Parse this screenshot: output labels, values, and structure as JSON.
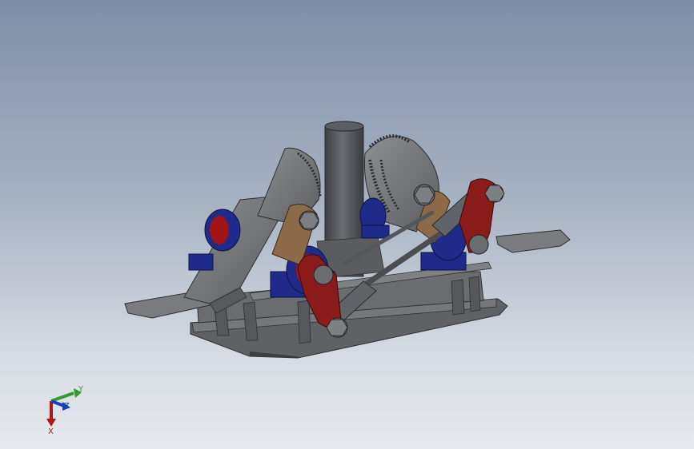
{
  "viewport": {
    "background_top": "#7f8ea7",
    "background_bottom": "#e6e9ee"
  },
  "model": {
    "part_colors": {
      "frame": "#6d6f73",
      "frame_dark": "#3f4144",
      "jaw": "#7b7c7f",
      "bearing_block": "#1f2a8a",
      "bearing_insert": "#a11414",
      "lever": "#8b1b1b",
      "bronze_link": "#8d6a47",
      "column": "#55585d",
      "rod": "#4b4d51"
    }
  },
  "triad": {
    "y_label": "Y",
    "x_label": "X",
    "z_label": "Z",
    "y_color": "#2e9b2e",
    "x_color": "#b01818",
    "z_color": "#1f3fb0"
  }
}
